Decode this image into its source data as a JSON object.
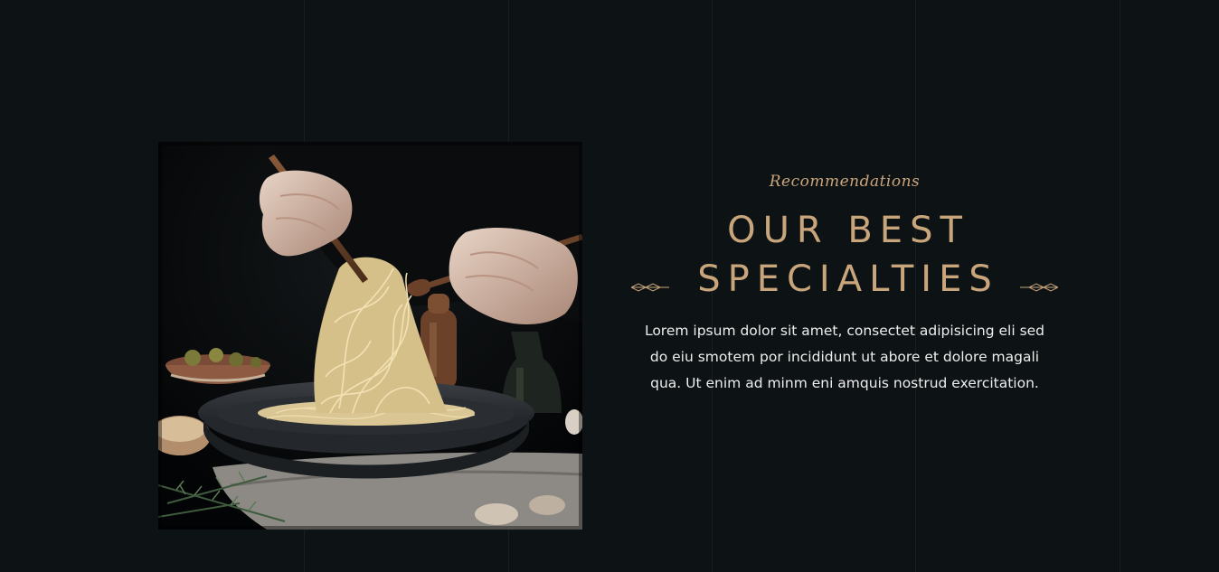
{
  "section": {
    "subtitle": "Recommendations",
    "title_line1": "OUR BEST",
    "title_line2": "SPECIALTIES",
    "description": "Lorem ipsum dolor sit amet, consectet adipisicing eli sed do eiu smotem por incididunt ut abore et dolore magali qua. Ut enim ad minm eni amquis nostrud exercitation."
  },
  "colors": {
    "background": "#0d1214",
    "accent": "#c9a57c",
    "text": "#eeeeee"
  },
  "image": {
    "subject": "pasta-twirled-with-wooden-utensils-over-pan"
  }
}
